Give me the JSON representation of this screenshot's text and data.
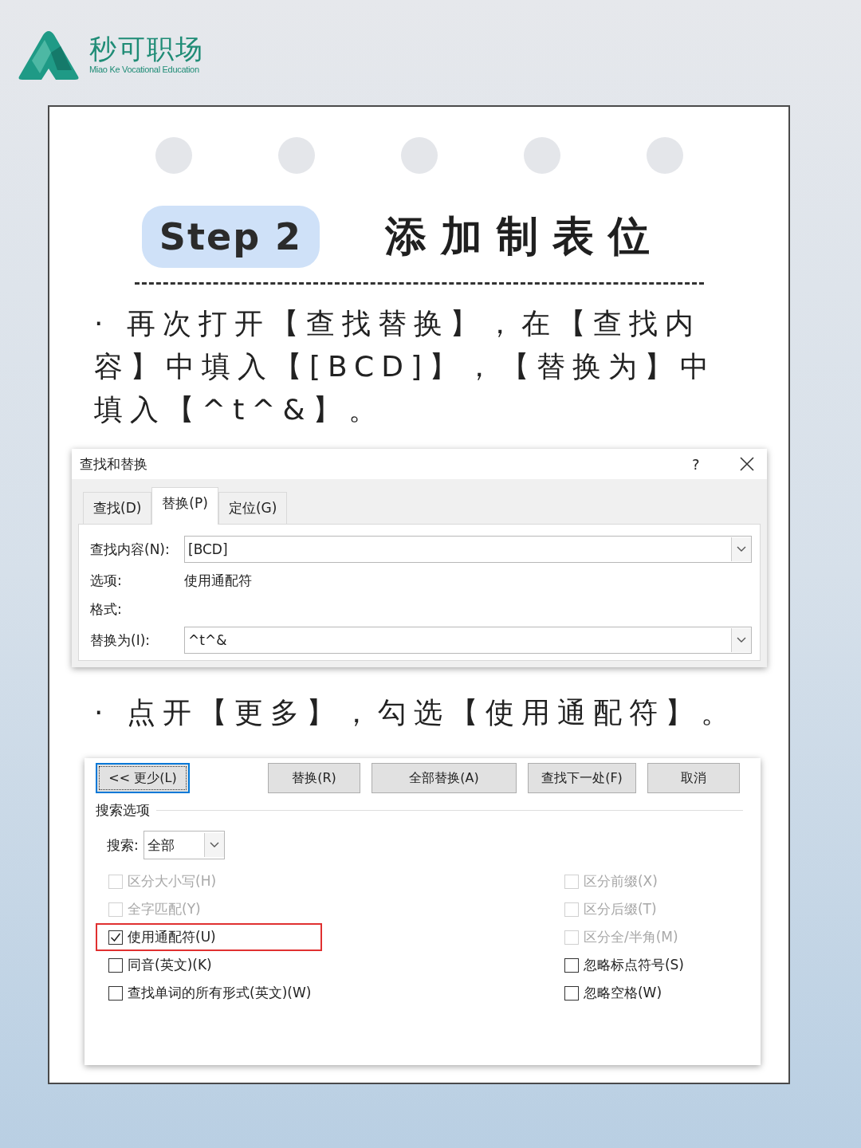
{
  "logo": {
    "name": "秒可职场",
    "subtitle": "Miao Ke Vocational Education"
  },
  "header": {
    "step": "Step 2",
    "title": "添加制表位"
  },
  "paragraphs": [
    "· 再次打开【查找替换】，在【查找内容】中填入【[BCD]】，【替换为】中填入【^t^&】。",
    "· 点开【更多】，勾选【使用通配符】。"
  ],
  "find_dialog": {
    "title": "查找和替换",
    "help": "?",
    "tabs": [
      {
        "label": "查找(D)",
        "selected": false
      },
      {
        "label": "替换(P)",
        "selected": true
      },
      {
        "label": "定位(G)",
        "selected": false
      }
    ],
    "fields": [
      {
        "kind": "combo",
        "label": "查找内容(N):",
        "value": "[BCD]"
      },
      {
        "kind": "info",
        "label": "选项:",
        "value": "使用通配符"
      },
      {
        "kind": "info",
        "label": "格式:"
      },
      {
        "kind": "combo",
        "label": "替换为(I):",
        "value": "^t^&"
      }
    ]
  },
  "options_dialog": {
    "buttons": [
      {
        "label": "<< 更少(L)",
        "focused": true
      },
      {
        "label": "替换(R)",
        "focused": false
      },
      {
        "label": "全部替换(A)",
        "focused": false
      },
      {
        "label": "查找下一处(F)",
        "focused": false
      },
      {
        "label": "取消",
        "focused": false
      }
    ],
    "section": "搜索选项",
    "search": {
      "label": "搜索:",
      "value": "全部"
    },
    "left_options": [
      {
        "label": "区分大小写(H)",
        "checked": false,
        "disabled": true,
        "highlighted": false
      },
      {
        "label": "全字匹配(Y)",
        "checked": false,
        "disabled": true,
        "highlighted": false
      },
      {
        "label": "使用通配符(U)",
        "checked": true,
        "disabled": false,
        "highlighted": true
      },
      {
        "label": "同音(英文)(K)",
        "checked": false,
        "disabled": false,
        "highlighted": false
      },
      {
        "label": "查找单词的所有形式(英文)(W)",
        "checked": false,
        "disabled": false,
        "highlighted": false
      }
    ],
    "right_options": [
      {
        "label": "区分前缀(X)",
        "checked": false,
        "disabled": true,
        "highlighted": false
      },
      {
        "label": "区分后缀(T)",
        "checked": false,
        "disabled": true,
        "highlighted": false
      },
      {
        "label": "区分全/半角(M)",
        "checked": false,
        "disabled": true,
        "highlighted": false
      },
      {
        "label": "忽略标点符号(S)",
        "checked": false,
        "disabled": false,
        "highlighted": false
      },
      {
        "label": "忽略空格(W)",
        "checked": false,
        "disabled": false,
        "highlighted": false
      }
    ]
  }
}
